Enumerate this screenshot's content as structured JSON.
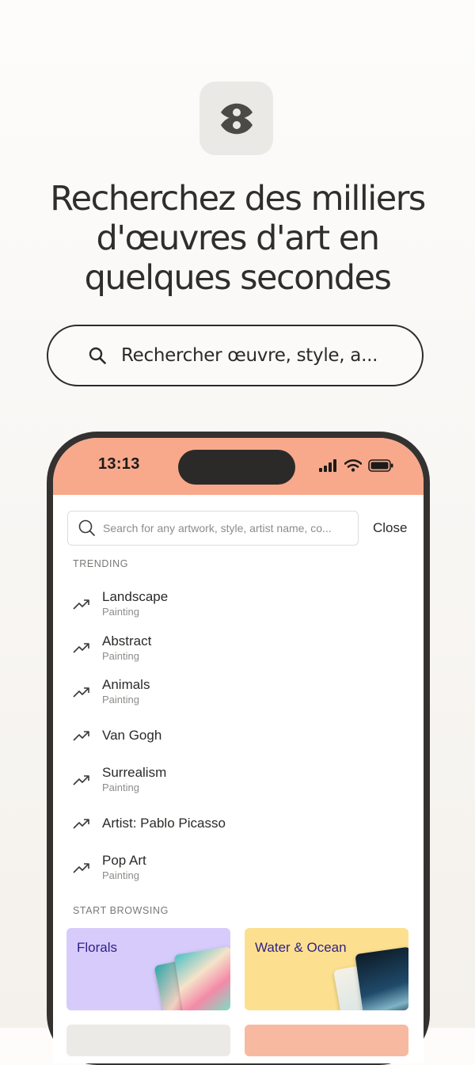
{
  "headline": {
    "line1": "Recherchez des milliers",
    "line2": "d'œuvres d'art en",
    "line3": "quelques secondes"
  },
  "promo_search": {
    "label": "Rechercher œuvre, style, a..."
  },
  "phone": {
    "status_bar": {
      "time": "13:13"
    },
    "search": {
      "placeholder": "Search for any artwork, style, artist name, co...",
      "close_label": "Close"
    },
    "trending_label": "TRENDING",
    "trending": [
      {
        "title": "Landscape",
        "subtitle": "Painting"
      },
      {
        "title": "Abstract",
        "subtitle": "Painting"
      },
      {
        "title": "Animals",
        "subtitle": "Painting"
      },
      {
        "title": "Van Gogh",
        "subtitle": ""
      },
      {
        "title": "Surrealism",
        "subtitle": "Painting"
      },
      {
        "title": "Artist: Pablo Picasso",
        "subtitle": ""
      },
      {
        "title": "Pop Art",
        "subtitle": "Painting"
      }
    ],
    "browse_label": "START BROWSING",
    "browse_cards": [
      {
        "label": "Florals",
        "color": "#d7cbfb"
      },
      {
        "label": "Water & Ocean",
        "color": "#fde08f"
      }
    ]
  },
  "colors": {
    "accent_status_bar": "#f8a98b",
    "text_primary": "#2b2a28",
    "text_muted": "#8e8c89",
    "card_label": "#2d1f8a"
  },
  "icons": {
    "app": "eye-logo-icon",
    "search": "search-icon",
    "trending": "trending-up-icon"
  }
}
